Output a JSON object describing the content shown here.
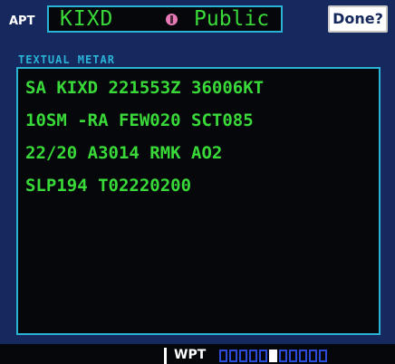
{
  "header": {
    "type_label": "APT",
    "identifier": "KIXD",
    "usage_icon": "public-airport-icon",
    "usage": "Public",
    "done_label": "Done?"
  },
  "section": {
    "title": "TEXTUAL METAR"
  },
  "metar": {
    "lines": [
      "SA KIXD 221553Z 36006KT",
      "10SM -RA FEW020 SCT085",
      "22/20 A3014 RMK AO2",
      "SLP194 T02220200"
    ]
  },
  "status_bar": {
    "page_group": "WPT",
    "page_count": 11,
    "active_page": 6
  },
  "colors": {
    "background": "#15295f",
    "panel": "#05070a",
    "border": "#2bb3d6",
    "text_green": "#3ad93a",
    "title_cyan": "#2bb3d6"
  }
}
